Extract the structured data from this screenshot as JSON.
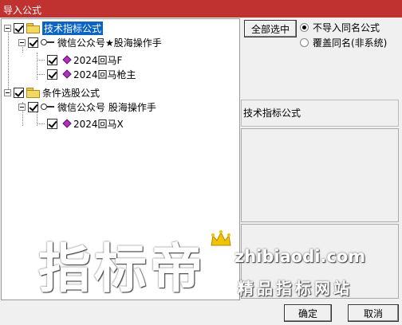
{
  "window": {
    "title": "导入公式"
  },
  "tree": {
    "nodes": [
      {
        "label": "技术指标公式"
      },
      {
        "label": "微信公众号★股海操作手"
      },
      {
        "label": "2024回马F"
      },
      {
        "label": "2024回马枪主"
      },
      {
        "label": "条件选股公式"
      },
      {
        "label": "微信公众号 股海操作手"
      },
      {
        "label": "2024回马X"
      }
    ]
  },
  "options": {
    "select_all_label": "全部选中",
    "radio_skip_label": "不导入同名公式",
    "radio_overwrite_label": "覆盖同名(非系统)"
  },
  "info": {
    "category_label": "技术指标公式"
  },
  "footer": {
    "ok_label": "确定",
    "cancel_label": "取消"
  },
  "watermark": {
    "main": "指标帝",
    "url": "zhibiaodi.com",
    "slogan": "精品指标网站"
  }
}
